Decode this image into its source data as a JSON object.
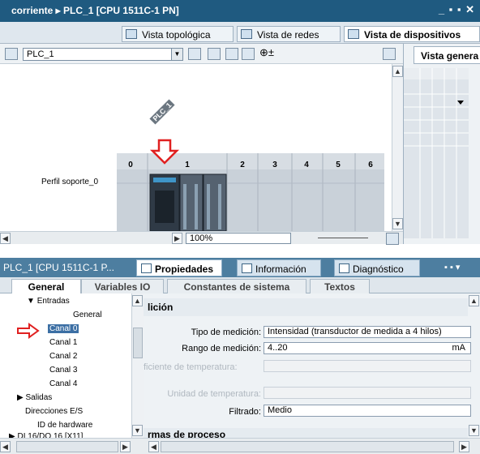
{
  "title_bar": {
    "title": "corriente ▸ PLC_1 [CPU 1511C-1 PN]",
    "window_buttons": "_ ▪ ▪ ✕"
  },
  "view_tabs": [
    {
      "label": "Vista topológica",
      "icon": "topology-icon"
    },
    {
      "label": "Vista de redes",
      "icon": "network-icon"
    },
    {
      "label": "Vista de dispositivos",
      "icon": "device-icon"
    }
  ],
  "toolbar": {
    "device_selector": "PLC_1"
  },
  "canvas": {
    "device_label": "PLC_1",
    "rail_label": "Perfil soporte_0",
    "slot_numbers": [
      "0",
      "1",
      "2",
      "3",
      "4",
      "5",
      "6"
    ]
  },
  "zoom": {
    "value": "100%"
  },
  "right_panel": {
    "tab_label": "Vista genera"
  },
  "inspector": {
    "object_title": "PLC_1 [CPU 1511C-1 P...",
    "tabs": [
      {
        "label": "Propiedades",
        "icon": "properties-icon"
      },
      {
        "label": "Información",
        "icon": "info-icon"
      },
      {
        "label": "Diagnóstico",
        "icon": "diagnostics-icon"
      }
    ],
    "sub_tabs": [
      "General",
      "Variables IO",
      "Constantes de sistema",
      "Textos"
    ]
  },
  "nav_tree": {
    "items": [
      {
        "label": "Entradas",
        "prefix": "▼"
      },
      {
        "label": "General",
        "prefix": ""
      },
      {
        "label": "Canal 0",
        "prefix": ""
      },
      {
        "label": "Canal 1",
        "prefix": ""
      },
      {
        "label": "Canal 2",
        "prefix": ""
      },
      {
        "label": "Canal 3",
        "prefix": ""
      },
      {
        "label": "Canal 4",
        "prefix": ""
      },
      {
        "label": "Salidas",
        "prefix": "▶"
      },
      {
        "label": "Direcciones E/S",
        "prefix": ""
      },
      {
        "label": "ID de hardware",
        "prefix": ""
      },
      {
        "label": "DI 16/DO 16 [X11]",
        "prefix": "▶"
      }
    ],
    "selected": "Canal 0"
  },
  "content": {
    "section_title": "lición",
    "section2_title": "rmas de proceso",
    "tipo_medicion": {
      "label": "Tipo de medición:",
      "value": "Intensidad (transductor de medida a 4 hilos)"
    },
    "rango_medicion": {
      "label": "Rango de medición:",
      "value": "4..20",
      "unit": "mA"
    },
    "coef_temperatura": {
      "label": "ficiente de temperatura:",
      "value": ""
    },
    "unidad_temperatura": {
      "label": "Unidad de temperatura:",
      "value": ""
    },
    "filtrado": {
      "label": "Filtrado:",
      "value": "Medio"
    }
  },
  "colors": {
    "title_bar": "#1f5a80",
    "inspector_bar": "#4d7ea0",
    "selection": "#3c6fa4",
    "red_arrow": "#e02020",
    "module_body": "#2f3a46"
  }
}
